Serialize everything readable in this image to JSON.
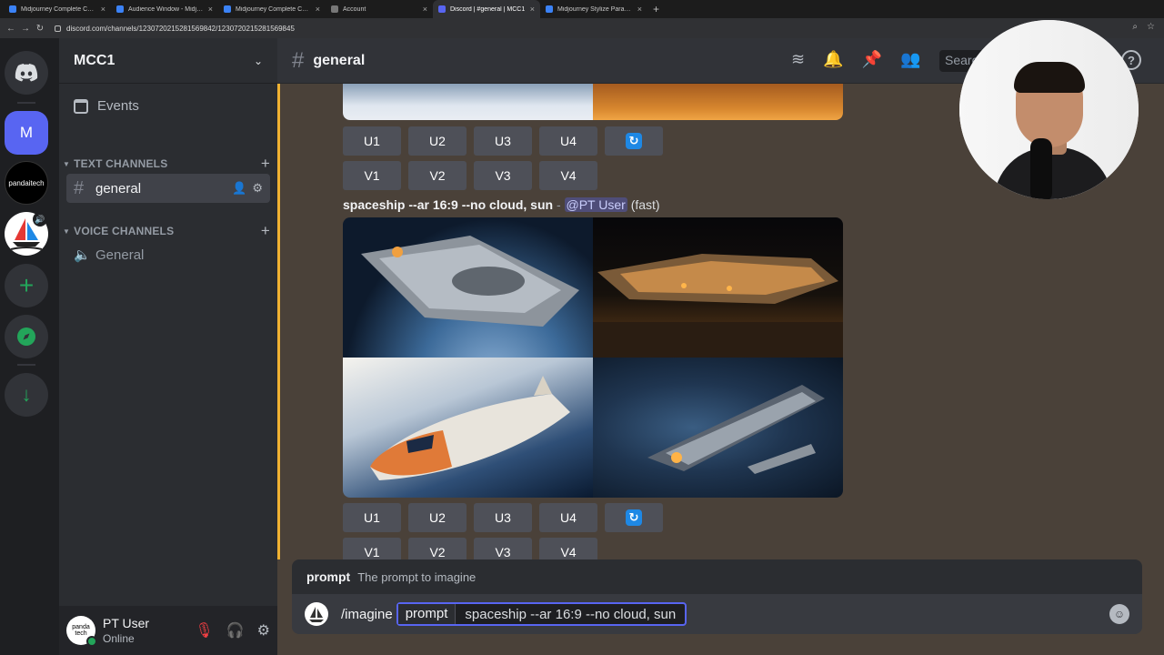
{
  "browser": {
    "tabs": [
      {
        "title": "Midjourney Complete Course",
        "active": false
      },
      {
        "title": "Audience Window - Midjourn",
        "active": false
      },
      {
        "title": "Midjourney Complete Course",
        "active": false
      },
      {
        "title": "Account",
        "active": false
      },
      {
        "title": "Discord | #general | MCC1",
        "active": true
      },
      {
        "title": "Midjourney Stylize Paramete",
        "active": false
      }
    ],
    "url": "discord.com/channels/1230720215281569842/1230720215281569845"
  },
  "servers": {
    "items": [
      {
        "name": "discord-home",
        "label": ""
      },
      {
        "name": "M",
        "label": "M"
      },
      {
        "name": "pandaitech",
        "label": "pandaitech"
      },
      {
        "name": "midjourney",
        "label": ""
      },
      {
        "name": "add-server",
        "label": "+"
      },
      {
        "name": "discover",
        "label": ""
      },
      {
        "name": "download",
        "label": "↓"
      }
    ]
  },
  "guild": {
    "name": "MCC1",
    "events_label": "Events",
    "text_category": "TEXT CHANNELS",
    "voice_category": "VOICE CHANNELS",
    "text_channels": [
      {
        "name": "general",
        "selected": true
      }
    ],
    "voice_channels": [
      {
        "name": "General"
      }
    ]
  },
  "user": {
    "name": "PT User",
    "status": "Online",
    "avatar_text": "panda tech"
  },
  "channel_header": {
    "name": "general",
    "search_placeholder": "Search",
    "icons": [
      "threads-icon",
      "bell-icon",
      "pin-icon",
      "members-icon"
    ]
  },
  "message": {
    "prompt_text": "spaceship --ar 16:9 --no cloud, sun",
    "separator": "-",
    "mention": "@PT User",
    "speed": "(fast)",
    "upscale_buttons": [
      "U1",
      "U2",
      "U3",
      "U4"
    ],
    "variation_buttons": [
      "V1",
      "V2",
      "V3",
      "V4"
    ]
  },
  "composer": {
    "option_name": "prompt",
    "option_desc": "The prompt to imagine",
    "command": "/imagine",
    "input_option": "prompt",
    "input_value": "spaceship --ar 16:9 --no cloud, sun"
  },
  "colors": {
    "accent": "#5865f2",
    "online": "#23a55a",
    "mute": "#f23f43",
    "highlight_bar": "#f0b232"
  }
}
